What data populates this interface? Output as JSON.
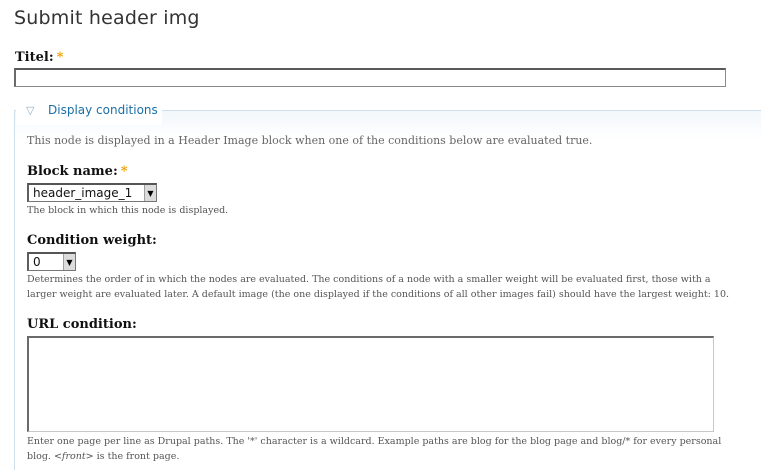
{
  "page": {
    "title": "Submit header img"
  },
  "title_field": {
    "label": "Titel:",
    "required_marker": "*",
    "value": ""
  },
  "fieldset": {
    "legend": "Display conditions",
    "toggle_icon": "collapse-triangle-icon",
    "description": "This node is displayed in a Header Image block when one of the conditions below are evaluated true."
  },
  "block_name": {
    "label": "Block name:",
    "required_marker": "*",
    "selected": "header_image_1",
    "help": "The block in which this node is displayed."
  },
  "condition_weight": {
    "label": "Condition weight:",
    "selected": "0",
    "help_line1": "Determines the order of in which the nodes are evaluated. The conditions of a node with a smaller weight will be evaluated first, those with a",
    "help_line2": "larger weight are evaluated later. A default image (the one displayed if the conditions of all other images fail) should have the largest weight: 10."
  },
  "url_condition": {
    "label": "URL condition:",
    "value": "",
    "help_line1": "Enter one page per line as Drupal paths. The '*' character is a wildcard. Example paths are blog for the blog page and blog/* for every personal",
    "help_line2_start": "blog. ",
    "help_front": "<front>",
    "help_line2_end": " is the front page."
  },
  "colors": {
    "link": "#1a6fa8",
    "required": "#f0a000",
    "fieldset_border": "#cfe0ec"
  }
}
